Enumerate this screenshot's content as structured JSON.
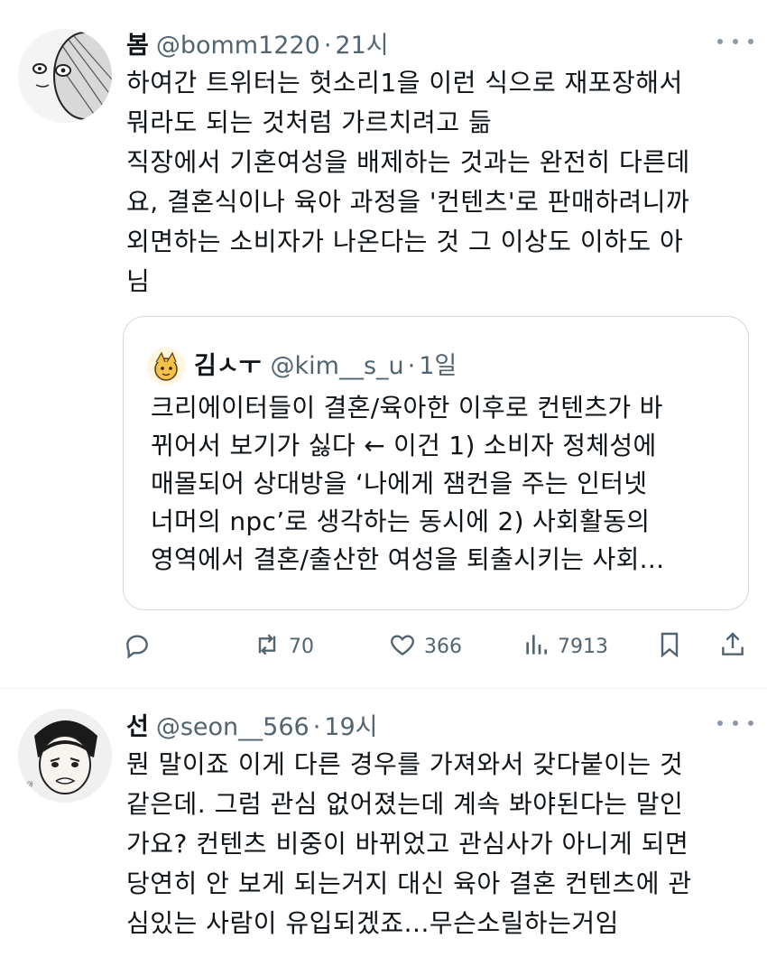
{
  "tweet1": {
    "name": "봄",
    "handle": "@bomm1220",
    "dot": "·",
    "time": "21시",
    "text": "하여간 트위터는 헛소리1을 이런 식으로 재포장해서\n뭐라도 되는 것처럼 가르치려고 듦\n직장에서 기혼여성을 배제하는 것과는 완전히 다른데\n요, 결혼식이나 육아 과정을 '컨텐츠'로 판매하려니까\n외면하는 소비자가 나온다는 것 그 이상도 이하도 아\n님",
    "quote": {
      "name": "김ㅅㅜ",
      "handle": "@kim__s_u",
      "dot": "·",
      "time": "1일",
      "text": "크리에이터들이 결혼/육아한 이후로 컨텐츠가 바\n뀌어서 보기가 싫다 ← 이건 1) 소비자 정체성에\n매몰되어 상대방을 ‘나에게 잼컨을 주는 인터넷\n너머의 npc’로 생각하는 동시에 2) 사회활동의\n영역에서 결혼/출산한 여성을 퇴출시키는 사회..."
    },
    "actions": {
      "reply_icon": "reply-icon",
      "retweet_icon": "retweet-icon",
      "retweet_count": "70",
      "like_icon": "heart-icon",
      "like_count": "366",
      "views_icon": "views-icon",
      "views_count": "7913",
      "bookmark_icon": "bookmark-icon",
      "share_icon": "share-icon"
    }
  },
  "tweet2": {
    "name": "선",
    "handle": "@seon__566",
    "dot": "·",
    "time": "19시",
    "text": "뭔 말이죠 이게 다른 경우를 가져와서 갖다붙이는 것\n같은데. 그럼 관심 없어졌는데 계속 봐야된다는 말인\n가요? 컨텐츠 비중이 바뀌었고 관심사가 아니게 되면\n당연히 안 보게 되는거지 대신 육아 결혼 컨텐츠에 관\n심있는 사람이 유입되겠죠...무슨소릴하는거임"
  },
  "colors": {
    "text": "#0f1419",
    "secondary": "#536471",
    "border": "#cfd9de"
  }
}
